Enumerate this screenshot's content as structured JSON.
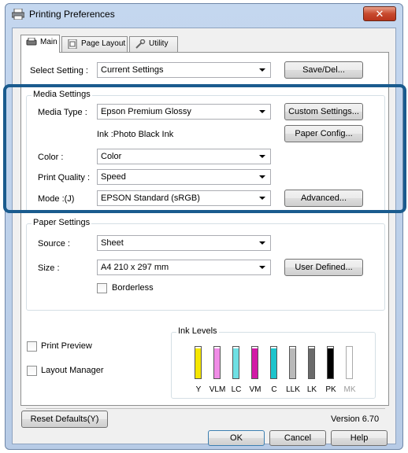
{
  "window": {
    "title": "Printing Preferences",
    "close_symbol": "✕"
  },
  "tabs": [
    {
      "label": "Main",
      "icon": "printer-icon"
    },
    {
      "label": "Page Layout",
      "icon": "page-icon"
    },
    {
      "label": "Utility",
      "icon": "wrench-icon"
    }
  ],
  "select_setting": {
    "label": "Select Setting :",
    "value": "Current Settings",
    "save_button": "Save/Del..."
  },
  "media_settings": {
    "title": "Media Settings",
    "media_type_label": "Media Type :",
    "media_type_value": "Epson Premium Glossy",
    "custom_settings_button": "Custom Settings...",
    "ink_text": "Ink :Photo Black Ink",
    "paper_config_button": "Paper Config...",
    "color_label": "Color :",
    "color_value": "Color",
    "print_quality_label": "Print Quality :",
    "print_quality_value": "Speed",
    "mode_label": "Mode :(J)",
    "mode_value": "EPSON Standard (sRGB)",
    "advanced_button": "Advanced..."
  },
  "paper_settings": {
    "title": "Paper Settings",
    "source_label": "Source :",
    "source_value": "Sheet",
    "size_label": "Size :",
    "size_value": "A4 210 x 297 mm",
    "user_defined_button": "User Defined...",
    "borderless_label": "Borderless"
  },
  "options": {
    "print_preview_label": "Print Preview",
    "layout_manager_label": "Layout Manager"
  },
  "ink_levels": {
    "title": "Ink Levels",
    "inks": [
      {
        "label": "Y",
        "color": "#f5e600",
        "level": 0.95
      },
      {
        "label": "VLM",
        "color": "#f08ce6",
        "level": 0.95
      },
      {
        "label": "LC",
        "color": "#6fe0e4",
        "level": 0.95
      },
      {
        "label": "VM",
        "color": "#d21aa6",
        "level": 0.95
      },
      {
        "label": "C",
        "color": "#1cc4cc",
        "level": 0.95
      },
      {
        "label": "LLK",
        "color": "#b9b9b9",
        "level": 0.95
      },
      {
        "label": "LK",
        "color": "#6a6a6a",
        "level": 0.95
      },
      {
        "label": "PK",
        "color": "#000000",
        "level": 0.95
      },
      {
        "label": "MK",
        "color": "#bbbbbb",
        "level": 0.0
      }
    ]
  },
  "footer": {
    "reset_defaults_button": "Reset Defaults(Y)",
    "version_text": "Version 6.70",
    "ok_button": "OK",
    "cancel_button": "Cancel",
    "help_button": "Help"
  },
  "colors": {
    "highlight": "#1a5b8e"
  }
}
